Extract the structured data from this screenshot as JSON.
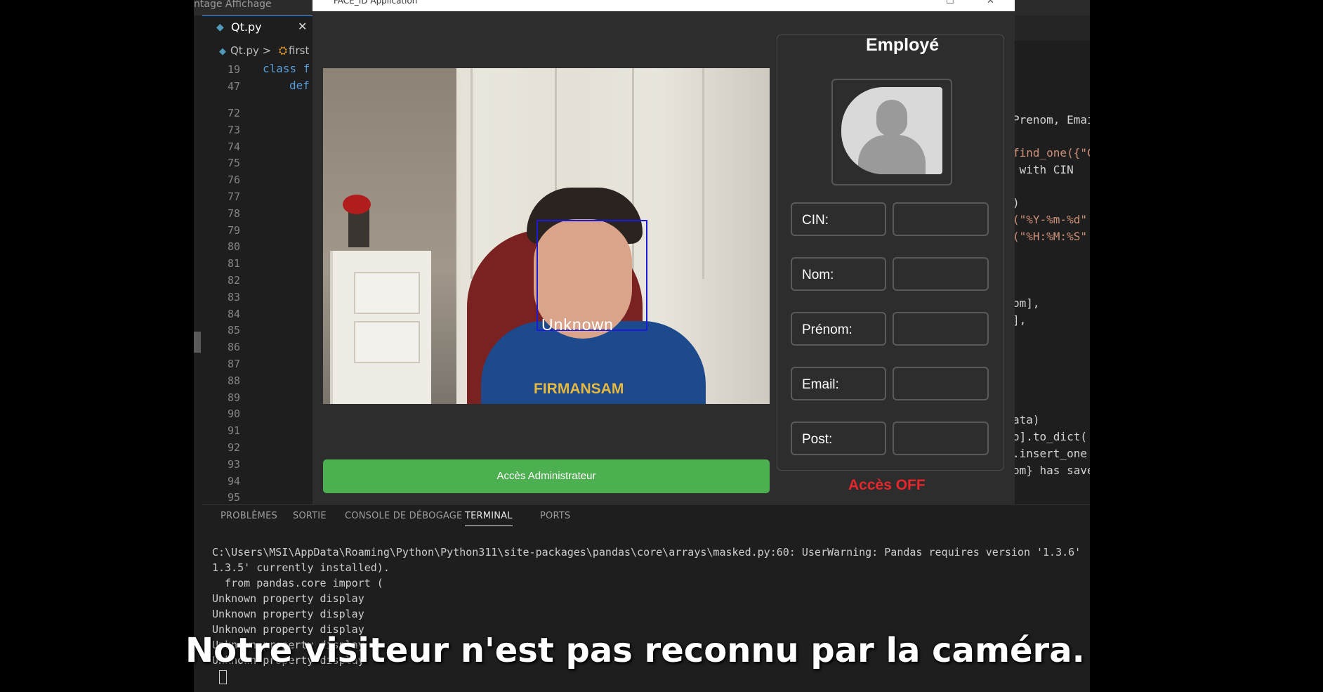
{
  "editor": {
    "top_left_text": "ntage  Affichage",
    "tab": {
      "icon": "python-file-icon",
      "name": "Qt.py",
      "close": "✕"
    },
    "breadcrumb": {
      "file": "Qt.py",
      "separator": ">",
      "symbol": "first"
    },
    "sticky_lines": [
      {
        "n": "19",
        "code": "class f"
      },
      {
        "n": "47",
        "code": "def"
      }
    ],
    "line_numbers": [
      "72",
      "73",
      "74",
      "75",
      "76",
      "77",
      "78",
      "79",
      "80",
      "81",
      "82",
      "83",
      "84",
      "85",
      "86",
      "87",
      "88",
      "89",
      "90",
      "91",
      "92",
      "93",
      "94",
      "95"
    ],
    "right_code": [
      "Prenom, Emai",
      "find_one({\"C",
      " with CIN ",
      ")",
      "(\"%Y-%m-%d\"",
      "(\"%H:%M:%S\"",
      "om],",
      "],",
      "ata)",
      "o].to_dict(",
      ".insert_one",
      "om} has save"
    ]
  },
  "panel": {
    "tabs": [
      "PROBLÈMES",
      "SORTIE",
      "CONSOLE DE DÉBOGAGE",
      "TERMINAL",
      "PORTS"
    ],
    "active_tab": "TERMINAL",
    "terminal_lines": [
      "C:\\Users\\MSI\\AppData\\Roaming\\Python\\Python311\\site-packages\\pandas\\core\\arrays\\masked.py:60: UserWarning: Pandas requires version '1.3.6'",
      "1.3.5' currently installed).",
      "  from pandas.core import (",
      "Unknown property display",
      "Unknown property display",
      "Unknown property display",
      "Unknown property display",
      "Unknown property display"
    ]
  },
  "app": {
    "window_title": "FACE_ID Application",
    "window_controls": {
      "maximize": "☐",
      "close": "✕"
    },
    "camera": {
      "face_label": "Unknown",
      "shirt_text": "FIRMANSAM",
      "box_color": "#1a1ad8"
    },
    "admin_button": "Accès Administrateur",
    "admin_button_color": "#4caf50",
    "employee_panel": {
      "title": "Employé",
      "photo_icon": "user-placeholder-icon",
      "fields": [
        {
          "label": "CIN:",
          "value": ""
        },
        {
          "label": "Nom:",
          "value": ""
        },
        {
          "label": "Prénom:",
          "value": ""
        },
        {
          "label": "Email:",
          "value": ""
        },
        {
          "label": "Post:",
          "value": ""
        }
      ]
    },
    "access_status": "Accès OFF",
    "access_status_color": "#e8262b"
  },
  "subtitle": "Notre visiteur n'est pas reconnu par la caméra."
}
